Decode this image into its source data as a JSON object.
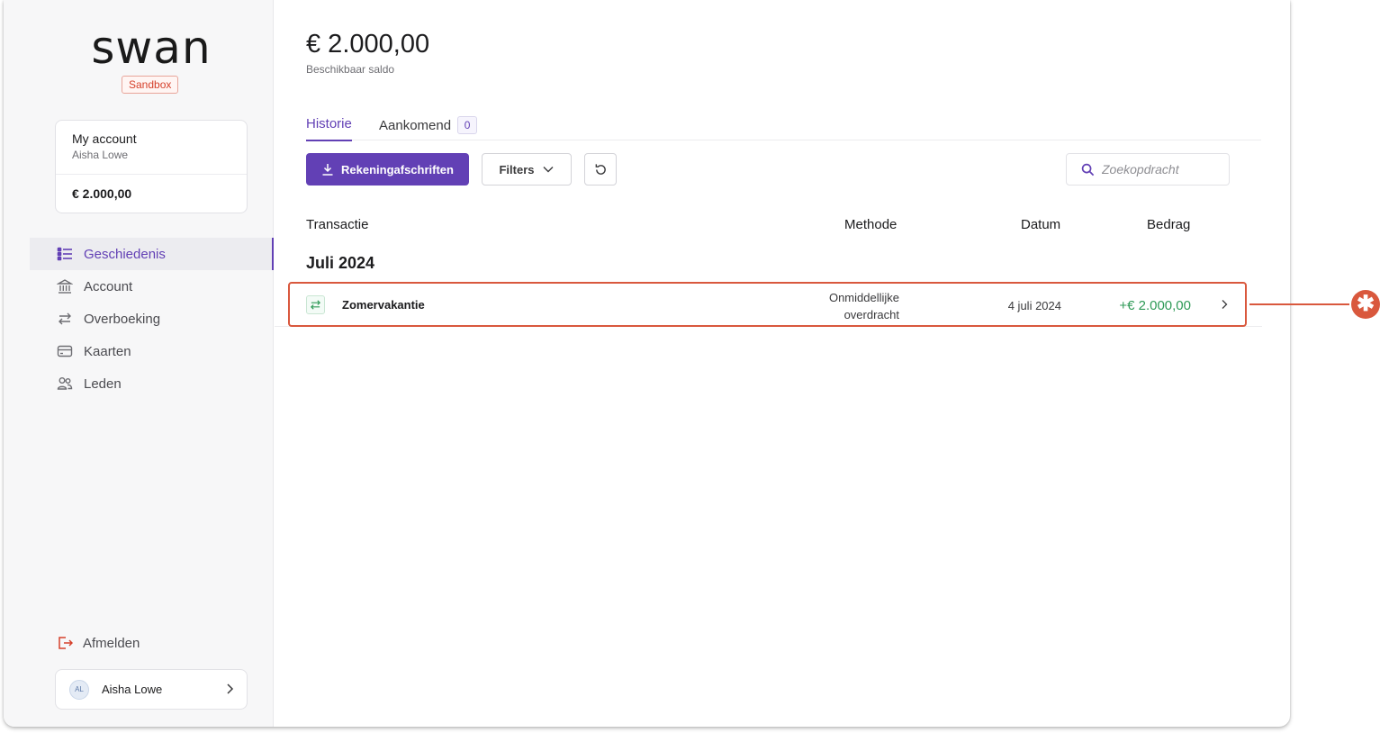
{
  "brand": {
    "logo": "swan",
    "environment": "Sandbox"
  },
  "account_card": {
    "name": "My account",
    "holder": "Aisha Lowe",
    "balance": "€ 2.000,00"
  },
  "nav": {
    "items": [
      {
        "label": "Geschiedenis",
        "icon": "list-icon",
        "active": true
      },
      {
        "label": "Account",
        "icon": "bank-icon",
        "active": false
      },
      {
        "label": "Overboeking",
        "icon": "transfer-icon",
        "active": false
      },
      {
        "label": "Kaarten",
        "icon": "card-icon",
        "active": false
      },
      {
        "label": "Leden",
        "icon": "members-icon",
        "active": false
      }
    ],
    "logout_label": "Afmelden"
  },
  "user": {
    "initials": "AL",
    "name": "Aisha Lowe"
  },
  "main": {
    "balance_amount": "€ 2.000,00",
    "balance_label": "Beschikbaar saldo",
    "tabs": [
      {
        "label": "Historie",
        "active": true
      },
      {
        "label": "Aankomend",
        "count": "0",
        "active": false
      }
    ],
    "toolbar": {
      "statements_label": "Rekeningafschriften",
      "filters_label": "Filters",
      "search_placeholder": "Zoekopdracht"
    },
    "columns": {
      "transaction": "Transactie",
      "method": "Methode",
      "date": "Datum",
      "amount": "Bedrag"
    },
    "groups": [
      {
        "title": "Juli 2024",
        "transactions": [
          {
            "name": "Zomervakantie",
            "method_line1": "Onmiddellijke",
            "method_line2": "overdracht",
            "date": "4 juli 2024",
            "amount": "+€ 2.000,00"
          }
        ]
      }
    ]
  },
  "annotation": {
    "marker": "✱",
    "color": "#d9583d"
  },
  "colors": {
    "accent": "#6240b5",
    "positive": "#2f9a57",
    "danger": "#d5402b"
  }
}
